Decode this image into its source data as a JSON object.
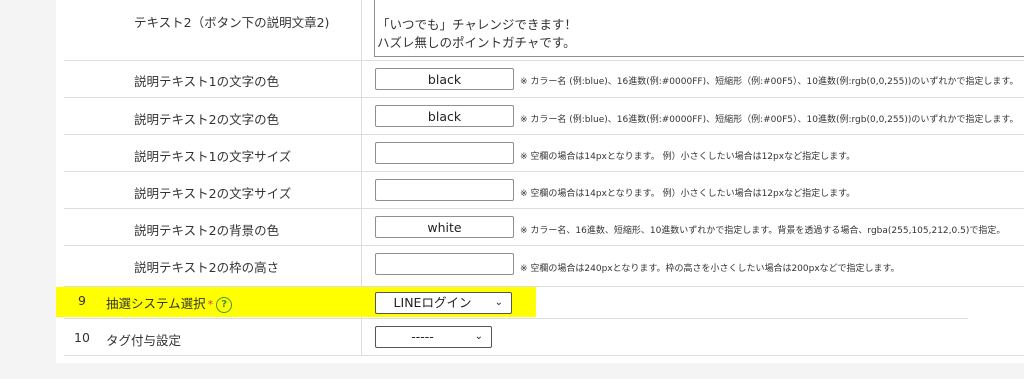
{
  "rows": {
    "text2": {
      "label": "テキスト2（ボタン下の説明文章2)",
      "value_line1": "「いつでも」チャレンジできます！",
      "value_line2": "ハズレ無しのポイントガチャです。"
    },
    "desc1_color": {
      "label": "説明テキスト1の文字の色",
      "value": "black",
      "hint": "※ カラー名 (例:blue)、16進数(例:#0000FF)、短縮形（例:#00F5）、10進数(例:rgb(0,0,255))のいずれかで指定します。"
    },
    "desc2_color": {
      "label": "説明テキスト2の文字の色",
      "value": "black",
      "hint": "※ カラー名 (例:blue)、16進数(例:#0000FF)、短縮形（例:#00F5）、10進数(例:rgb(0,0,255))のいずれかで指定します。"
    },
    "desc1_size": {
      "label": "説明テキスト1の文字サイズ",
      "value": "",
      "hint": "※ 空欄の場合は14pxとなります。 例）小さくしたい場合は12pxなど指定します。"
    },
    "desc2_size": {
      "label": "説明テキスト2の文字サイズ",
      "value": "",
      "hint": "※ 空欄の場合は14pxとなります。 例）小さくしたい場合は12pxなど指定します。"
    },
    "desc2_bg": {
      "label": "説明テキスト2の背景の色",
      "value": "white",
      "hint": "※ カラー名、16進数、短縮形、10進数いずれかで指定します。背景を透過する場合、rgba(255,105,212,0.5)で指定。"
    },
    "desc2_frame_height": {
      "label": "説明テキスト2の枠の高さ",
      "value": "",
      "hint": "※ 空欄の場合は240pxとなります。枠の高さを小さくしたい場合は200pxなどで指定します。"
    },
    "lottery_system": {
      "number": "9",
      "label": "抽選システム選択",
      "required_mark": "*",
      "help_icon": "?",
      "selected": "LINEログイン"
    },
    "tag_setting": {
      "number": "10",
      "label": "タグ付与設定",
      "selected": "-----"
    }
  },
  "colors": {
    "highlight": "#ffff00",
    "help_icon": "#3a9a3a",
    "required": "#e04040"
  }
}
